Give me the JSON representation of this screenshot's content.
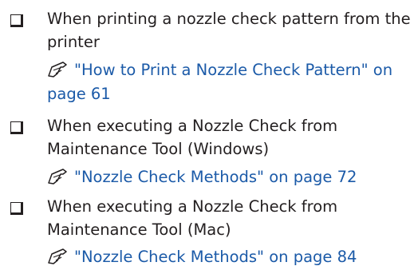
{
  "items": [
    {
      "lines": [
        "When printing a nozzle check pattern from the",
        "printer"
      ],
      "ref_icon": "reference-hand-icon",
      "ref_lines": [
        "\"How to Print a Nozzle Check Pattern\" on",
        "page 61"
      ]
    },
    {
      "lines": [
        "When executing a Nozzle Check from",
        "Maintenance Tool (Windows)"
      ],
      "ref_icon": "reference-hand-icon",
      "ref_lines": [
        "\"Nozzle Check Methods\" on page 72"
      ]
    },
    {
      "lines": [
        "When executing a Nozzle Check from",
        "Maintenance Tool (Mac)"
      ],
      "ref_icon": "reference-hand-icon",
      "ref_lines": [
        "\"Nozzle Check Methods\" on page 84"
      ]
    }
  ],
  "colors": {
    "text": "#231f20",
    "link": "#1b5aa8"
  }
}
